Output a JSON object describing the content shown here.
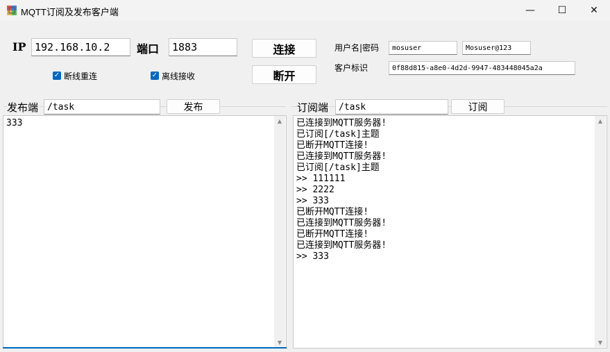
{
  "window": {
    "title": "MQTT订阅及发布客户端",
    "controls": {
      "minimize": "—",
      "maximize": "☐",
      "close": "✕"
    }
  },
  "connection": {
    "ip_label": "IP",
    "ip_value": "192.168.10.2",
    "port_label": "端口",
    "port_value": "1883",
    "connect_button": "连接",
    "disconnect_button": "断开",
    "auto_reconnect_label": "断线重连",
    "auto_reconnect_checked": true,
    "offline_receive_label": "离线接收",
    "offline_receive_checked": true,
    "credentials_label": "用户名|密码",
    "username_value": "mosuser",
    "password_value": "Mosuser@123",
    "client_id_label": "客户标识",
    "client_id_value": "0f88d815-a8e0-4d2d-9947-483448045a2a"
  },
  "publisher": {
    "label": "发布端",
    "topic_value": "/task",
    "publish_button": "发布",
    "message_lines": [
      "333"
    ]
  },
  "subscriber": {
    "label": "订阅端",
    "topic_value": "/task",
    "subscribe_button": "订阅",
    "log_lines": [
      "已连接到MQTT服务器!",
      "已订阅[/task]主题",
      "已断开MQTT连接!",
      "已连接到MQTT服务器!",
      "已订阅[/task]主题",
      ">> 111111",
      ">> 2222",
      ">> 333",
      "已断开MQTT连接!",
      "已连接到MQTT服务器!",
      "已断开MQTT连接!",
      "已连接到MQTT服务器!",
      ">> 333"
    ]
  },
  "colors": {
    "accent": "#0067c0",
    "window_bg": "#f0f0f0"
  }
}
